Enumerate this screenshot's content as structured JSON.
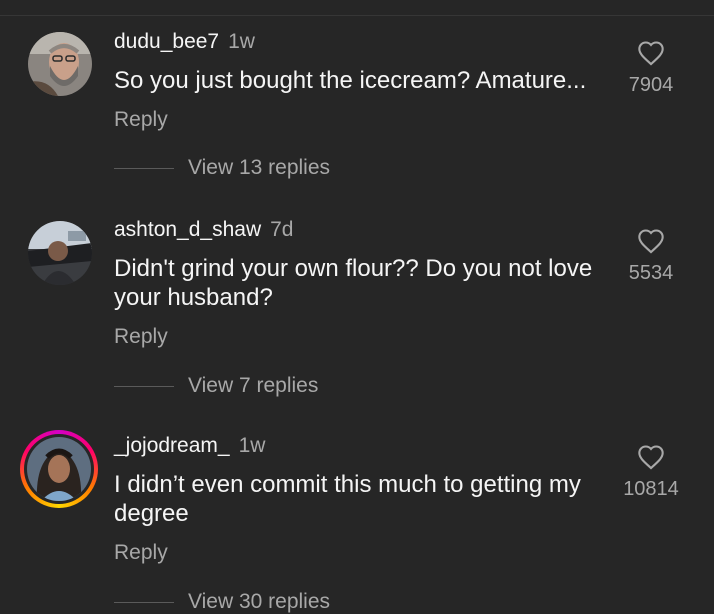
{
  "comments": [
    {
      "username": "dudu_bee7",
      "time": "1w",
      "text": "So you just bought the icecream? Amature...",
      "reply_label": "Reply",
      "view_replies": "View 13 replies",
      "likes": "7904",
      "avatar_icon": "profile-photo-bearded-man",
      "has_story_ring": false
    },
    {
      "username": "ashton_d_shaw",
      "time": "7d",
      "text": "Didn't grind your own flour?? Do you not love your husband?",
      "reply_label": "Reply",
      "view_replies": "View 7 replies",
      "likes": "5534",
      "avatar_icon": "profile-photo-car-interior",
      "has_story_ring": false
    },
    {
      "username": "_jojodream_",
      "time": "1w",
      "text": "I didn’t even commit this much to getting my degree",
      "reply_label": "Reply",
      "view_replies": "View 30 replies",
      "likes": "10814",
      "avatar_icon": "profile-photo-woman",
      "has_story_ring": true
    }
  ],
  "colors": {
    "background": "#262626",
    "primary_text": "#f5f5f5",
    "secondary_text": "#a8a8a8"
  }
}
